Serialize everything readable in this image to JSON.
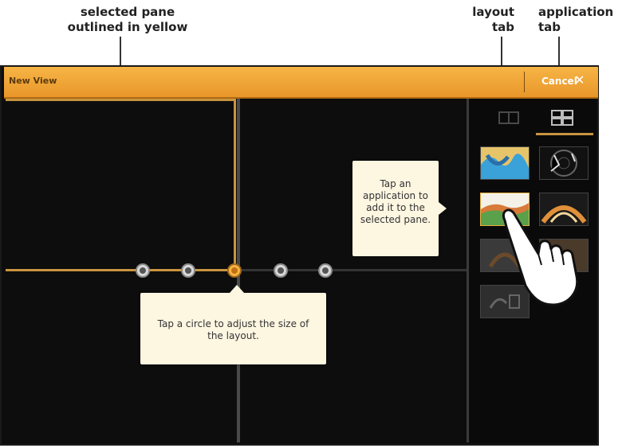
{
  "callouts": {
    "selected_pane": "selected pane\noutlined in yellow",
    "layout_tab": "layout\ntab",
    "application_tab": "application\ntab"
  },
  "window": {
    "title": "New View",
    "cancel_label": "Cancel",
    "close_glyph": "✕"
  },
  "layout": {
    "size_circles": [
      "size-1",
      "size-2",
      "size-3",
      "size-4",
      "size-5"
    ],
    "active_circle_index": 2
  },
  "sidebar": {
    "tabs": [
      {
        "name": "layout",
        "icon": "layout-icon",
        "selected": false
      },
      {
        "name": "application",
        "icon": "four-grid-icon",
        "selected": true
      }
    ],
    "apps": [
      "chart-app",
      "radar-app",
      "sonar-app",
      "down-imaging-app",
      "side-imaging-app",
      "360-imaging-app",
      "instrument-app"
    ]
  },
  "tooltips": {
    "app": "Tap an application to add it to the selected pane.",
    "size": "Tap a circle to adjust the size of the layout."
  },
  "colors": {
    "title_bar": "#f0a838",
    "selection": "#c99440",
    "tooltip": "#fdf6e1",
    "background": "#0d0d0d"
  }
}
